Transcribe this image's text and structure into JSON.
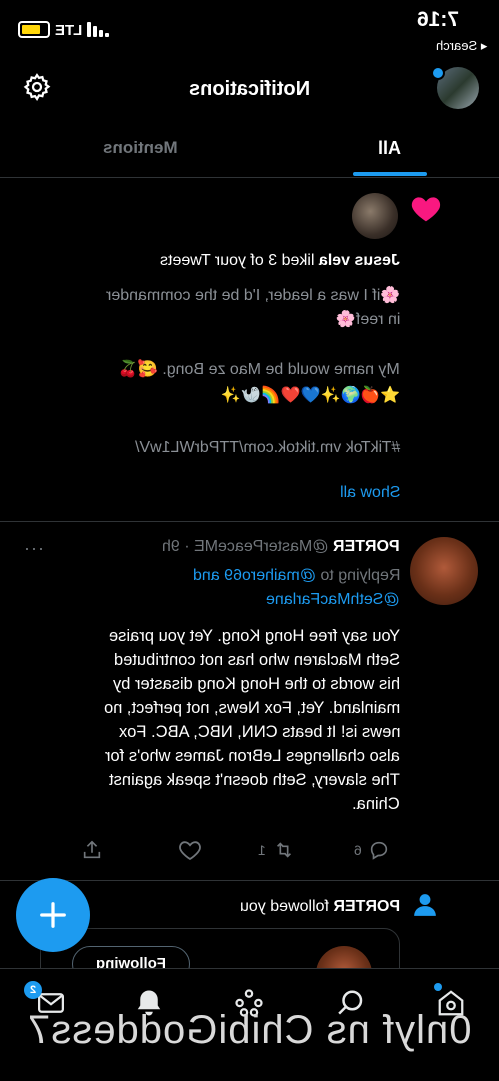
{
  "status_bar": {
    "time": "7:16",
    "back_label": "◂ Search",
    "network": "LTE"
  },
  "header": {
    "title": "Notifications"
  },
  "tabs": [
    {
      "label": "All",
      "active": true
    },
    {
      "label": "Mentions",
      "active": false
    }
  ],
  "like_notification": {
    "liker_name": "Jesus vela",
    "liked_text": " liked 3 of your Tweets",
    "tweet_lines": [
      "🌸if I was a leader, I'd be the commander",
      "in reef🌸",
      "",
      "My name would be Mao ze Bong. 🥰🍒",
      "⭐🍎🌍✨💙❤️🌈🦭✨",
      "",
      "#TikTok vm.tiktok.com/TTPdrWL1wV/"
    ],
    "show_all": "Show all"
  },
  "reply_tweet": {
    "author": "PORTER",
    "handle_time": " @MasterPeaceME · 9h",
    "more": "···",
    "replying_to_prefix": "Replying to ",
    "replying_user1": "@maihero69",
    "replying_and": " and",
    "replying_user2": "@SethMacFarlane",
    "text_lines": [
      "You say free Hong Kong. Yet you praise",
      "Seth Maclaren who has not contributed",
      "his words to the Hong Kong disaster by",
      "mainland. Yet, Fox News, not perfect, no",
      "news is! It beats CNN, NBC, ABC. Fox",
      "also challenges LeBron James who's for",
      "The slavery, Seth doesn't speak against",
      "China."
    ],
    "reply_count": "6",
    "retweet_count": "1"
  },
  "follow_notification": {
    "name": "PORTER",
    "text": " followed you",
    "button_label": "Following"
  },
  "bottom_nav": {
    "messages_badge": "2"
  },
  "watermark": "0nlyf ns ChibiGoddess7",
  "colors": {
    "accent": "#1d9bf0",
    "heart": "#f91880",
    "muted": "#71767b",
    "background": "#000000"
  }
}
